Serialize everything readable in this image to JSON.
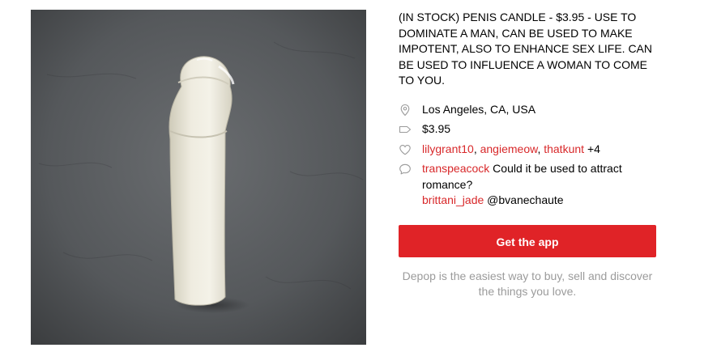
{
  "product": {
    "description": "(IN STOCK) PENIS CANDLE - $3.95 - USE TO DOMINATE A MAN, CAN BE USED TO MAKE IMPOTENT, ALSO TO ENHANCE SEX LIFE. CAN BE USED TO INFLUENCE A WOMAN TO COME TO YOU.",
    "location": "Los Angeles, CA, USA",
    "price": "$3.95"
  },
  "likes": {
    "users": [
      "lilygrant10",
      "angiemeow",
      "thatkunt"
    ],
    "separator": ",",
    "more": "+4"
  },
  "comments": [
    {
      "user": "transpeacock",
      "text": "Could it be used to attract romance?"
    },
    {
      "user": "brittani_jade",
      "text": "@bvanechaute"
    }
  ],
  "cta": {
    "label": "Get the app",
    "color": "#e02327"
  },
  "tagline": "Depop is the easiest way to buy, sell and discover the things you love.",
  "icons": {
    "location": "location-pin-icon",
    "price": "price-tag-icon",
    "likes": "heart-icon",
    "comments": "speech-bubble-icon"
  },
  "colors": {
    "accent": "#d8282a",
    "muted": "#9b9b9b"
  }
}
